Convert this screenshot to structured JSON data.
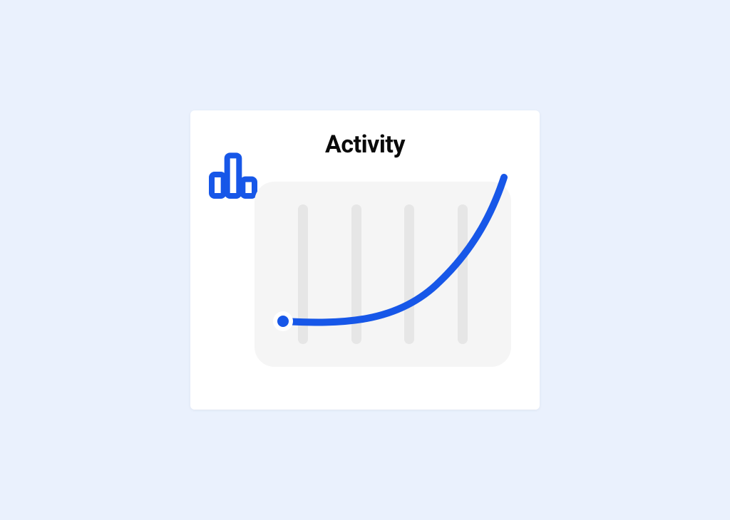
{
  "card": {
    "title": "Activity"
  },
  "chart_data": {
    "type": "line",
    "title": "Activity",
    "xlabel": "",
    "ylabel": "",
    "x": [
      0,
      1,
      2,
      3,
      4
    ],
    "values": [
      10,
      12,
      20,
      45,
      100
    ],
    "ylim": [
      0,
      100
    ],
    "grid": true,
    "legend_position": "none",
    "accent_color": "#1757e8",
    "panel_bg": "#f5f5f5",
    "grid_color": "#e6e6e6"
  }
}
